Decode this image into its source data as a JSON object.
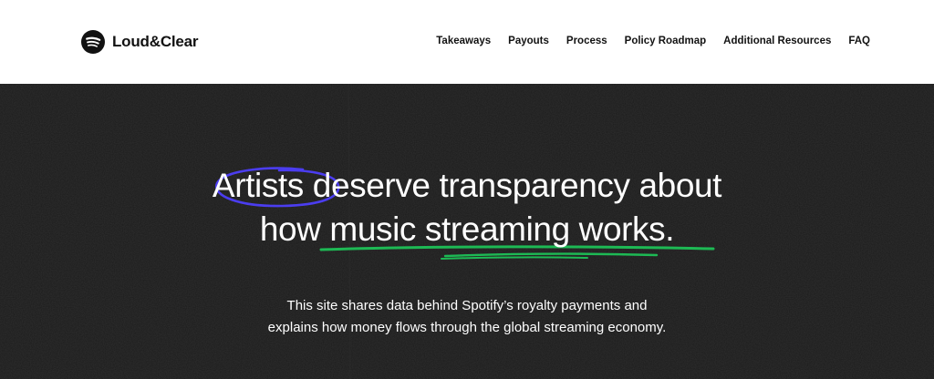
{
  "brand": {
    "name": "Loud&Clear",
    "icon": "spotify-logo-icon"
  },
  "nav": {
    "items": [
      {
        "label": "Takeaways"
      },
      {
        "label": "Payouts"
      },
      {
        "label": "Process"
      },
      {
        "label": "Policy Roadmap"
      },
      {
        "label": "Additional Resources"
      },
      {
        "label": "FAQ"
      }
    ]
  },
  "hero": {
    "headline_line1": "Artists deserve transparency about",
    "headline_line2": "how music streaming works.",
    "subtext_line1": "This site shares data behind Spotify’s royalty payments and",
    "subtext_line2": "explains how money flows through the global streaming economy."
  },
  "colors": {
    "header_bg": "#ffffff",
    "hero_bg": "#1b1b1b",
    "circle_accent": "#4b3df0",
    "underline_accent": "#1db954",
    "text_dark": "#121212",
    "text_light": "#ffffff"
  }
}
